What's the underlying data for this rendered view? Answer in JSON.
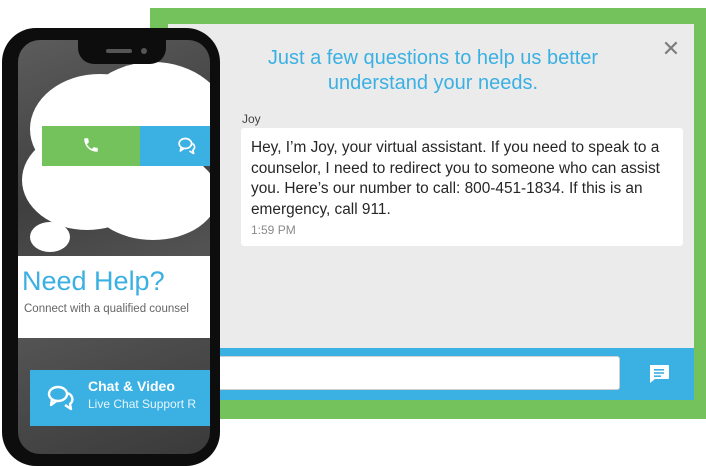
{
  "chat": {
    "title": "Just a few questions to help us better understand your needs.",
    "close_icon": "close-icon",
    "sender": "Joy",
    "message": "Hey, I’m Joy, your virtual assistant. If you need to speak to a counselor, I need to redirect you to someone who can assist you. Here’s our number to call: 800-451-1834. If this is an emergency, call 911.",
    "time": "1:59 PM",
    "input_value": "",
    "send_icon": "send-message-icon"
  },
  "phone": {
    "call_icon": "phone-icon",
    "chat_icon": "chat-bubbles-icon",
    "heading": "Need Help?",
    "subheading": "Connect with a qualified counsel",
    "cta_title": "Chat & Video",
    "cta_subtitle": "Live Chat Support R",
    "cta_icon": "chat-bubbles-icon"
  },
  "colors": {
    "green": "#73c25c",
    "blue": "#3ab0e3",
    "panel": "#ebebeb"
  }
}
